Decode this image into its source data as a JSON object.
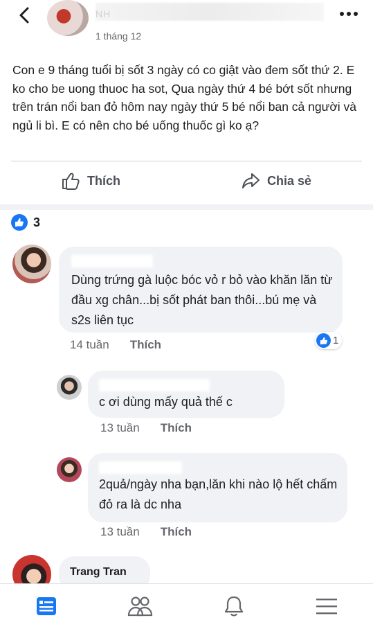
{
  "post": {
    "author_name": "NH",
    "timestamp": "1 tháng 12",
    "text": "Con e 9 tháng tuổi bị sốt 3 ngày có co giật vào đem sốt thứ 2. E ko cho be uong thuoc ha sot, Qua ngày thứ 4 bé bớt sốt nhưng trên trán nổi ban đỏ hôm nay ngày thứ 5 bé nổi ban cả người và ngủ li bì. E có nên cho bé uống thuốc gì ko ạ?"
  },
  "actions": {
    "like_label": "Thích",
    "share_label": "Chia sẻ"
  },
  "reactions": {
    "count": "3"
  },
  "comments": [
    {
      "text": "Dùng trứng gà luộc bóc vỏ r bỏ vào khăn lăn từ đầu xg chân...bị sốt phát ban thôi...bú mẹ và s2s liên tục",
      "time": "14 tuần",
      "like_label": "Thích",
      "reaction_count": "1"
    },
    {
      "text": "c ơi dùng mấy quả thế c",
      "time": "13 tuần",
      "like_label": "Thích"
    },
    {
      "text": "2quả/ngày nha bạn,lăn khi nào lộ hết chấm đỏ ra là dc nha",
      "time": "13 tuần",
      "like_label": "Thích"
    },
    {
      "author_name": "Trang Tran"
    }
  ],
  "icons": {
    "back": "back-arrow-icon",
    "more": "more-options-icon",
    "like": "thumbs-up-icon",
    "share": "share-arrow-icon",
    "feed": "news-feed-icon",
    "friends": "friends-icon",
    "notifications": "bell-icon",
    "menu": "hamburger-menu-icon"
  },
  "colors": {
    "accent": "#1877f2",
    "text": "#1c1e21",
    "muted": "#65676b",
    "bubble": "#f0f2f5"
  }
}
